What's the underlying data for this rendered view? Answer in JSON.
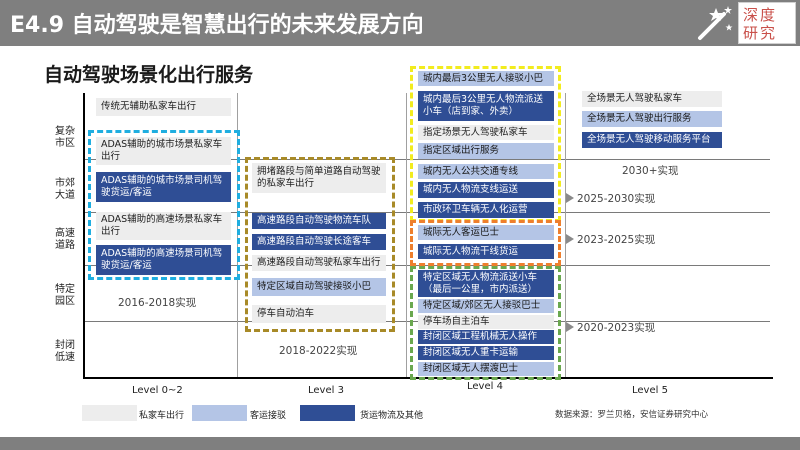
{
  "header": {
    "title": "E4.9 自动驾驶是智慧出行的未来发展方向",
    "logo_text": "深度研究"
  },
  "subtitle": "自动驾驶场景化出行服务",
  "chart_data": {
    "type": "matrix",
    "y_categories": [
      "复杂市区",
      "市郊大道",
      "高速道路",
      "特定园区",
      "封闭低速"
    ],
    "x_categories": [
      "Level 0~2",
      "Level 3",
      "Level 4",
      "Level 5"
    ],
    "legend": {
      "private": "私家车出行",
      "passenger": "客运接驳",
      "freight": "货运物流及其他"
    },
    "source": "数据来源：罗兰贝格，安信证券研究中心",
    "periods": {
      "p1": "2016-2018实现",
      "p2": "2018-2022实现",
      "p3": "2030+实现",
      "p4": "2025-2030实现",
      "p5": "2023-2025实现",
      "p6": "2020-2023实现"
    },
    "cells": {
      "l0": "传统无辅助私家车出行",
      "l1": "ADAS辅助的城市场景私家车出行",
      "l2": "ADAS辅助的城市场景司机驾驶货运/客运",
      "l3": "ADAS辅助的高速场景私家车出行",
      "l4": "ADAS辅助的高速场景司机驾驶货运/客运",
      "m1": "拥堵路段与简单道路自动驾驶的私家车出行",
      "m2": "高速路段自动驾驶物流车队",
      "m3": "高速路段自动驾驶长途客车",
      "m4": "高速路段自动驾驶私家车出行",
      "m5": "特定区域自动驾驶接驳小巴",
      "m6": "停车自动泊车",
      "n1": "城内最后3公里无人接驳小巴",
      "n2": "城内最后3公里无人物流派送小车（店到家、外卖）",
      "n3": "指定场景无人驾驶私家车",
      "n4": "指定区域出行服务",
      "n5": "城内无人公共交通专线",
      "n6": "城内无人物流支线运送",
      "n7": "市政环卫车辆无人化运营",
      "n8": "城际无人客运巴士",
      "n9": "城际无人物流干线货运",
      "n10": "特定区域无人物流派送小车（最后一公里，市内派送）",
      "n11": "特定区域/郊区无人接驳巴士",
      "n12": "停车场自主泊车",
      "n13": "封闭区域工程机械无人操作",
      "n14": "封闭区域无人重卡运输",
      "n15": "封闭区域无人摆渡巴士",
      "r1": "全场景无人驾驶私家车",
      "r2": "全场景无人驾驶出行服务",
      "r3": "全场景无人驾驶移动服务平台"
    }
  },
  "colors": {
    "private": "#ededed",
    "passenger": "#b4c5e6",
    "freight": "#2f4e95"
  }
}
